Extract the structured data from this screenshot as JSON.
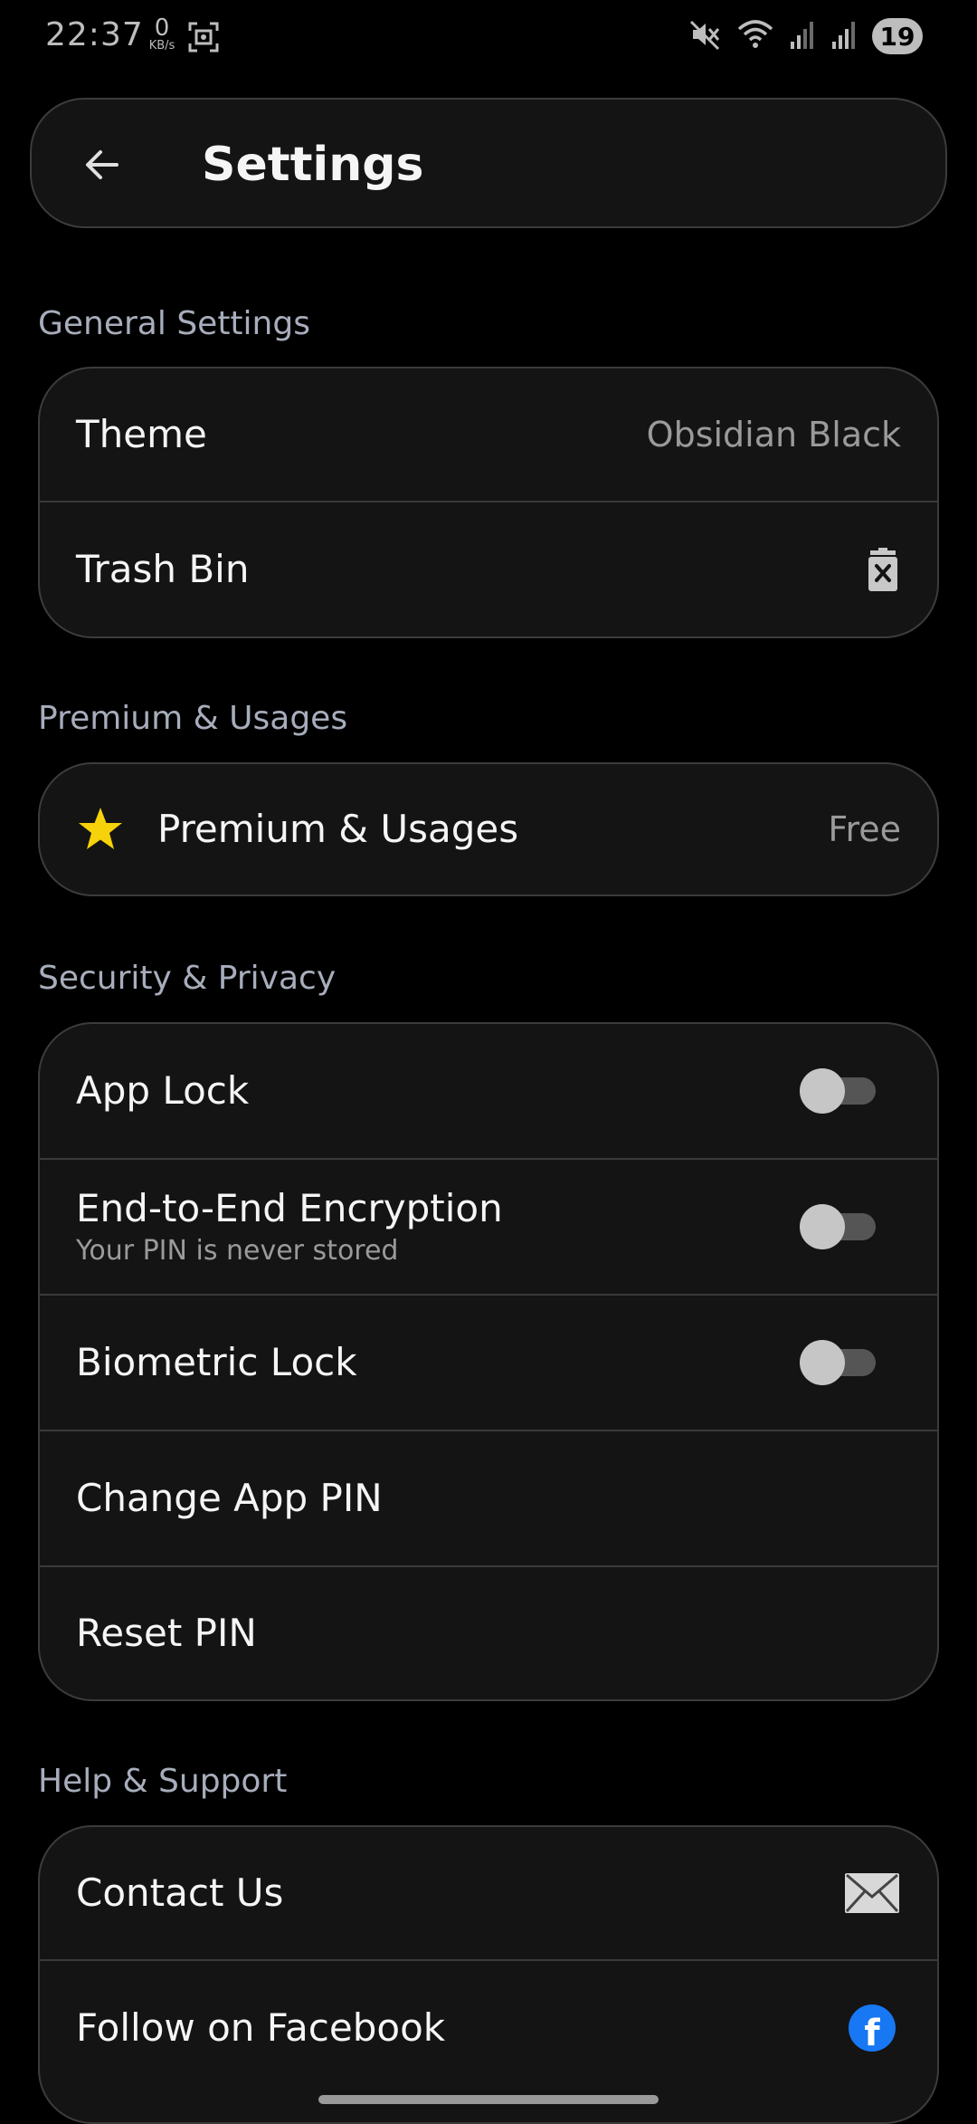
{
  "status_bar": {
    "time": "22:37",
    "speed_value": "0",
    "speed_unit": "KB/s",
    "battery": "19"
  },
  "header": {
    "title": "Settings",
    "back_icon": "arrow-left-icon"
  },
  "sections": {
    "general": {
      "title": "General Settings",
      "theme_label": "Theme",
      "theme_value": "Obsidian Black",
      "trash_label": "Trash Bin",
      "trash_icon": "trash-icon"
    },
    "premium": {
      "title": "Premium & Usages",
      "item_label": "Premium & Usages",
      "item_value": "Free",
      "star_icon": "star-icon",
      "star_color": "#f5d20a"
    },
    "security": {
      "title": "Security & Privacy",
      "app_lock_label": "App Lock",
      "app_lock_on": false,
      "e2e_label": "End-to-End Encryption",
      "e2e_sub": "Your PIN is never stored",
      "e2e_on": false,
      "biometric_label": "Biometric Lock",
      "biometric_on": false,
      "change_pin_label": "Change App PIN",
      "reset_pin_label": "Reset PIN"
    },
    "help": {
      "title": "Help & Support",
      "contact_label": "Contact Us",
      "contact_icon": "envelope-icon",
      "facebook_label": "Follow on Facebook",
      "facebook_icon": "facebook-icon",
      "facebook_glyph": "f",
      "facebook_color": "#1877f2"
    }
  }
}
